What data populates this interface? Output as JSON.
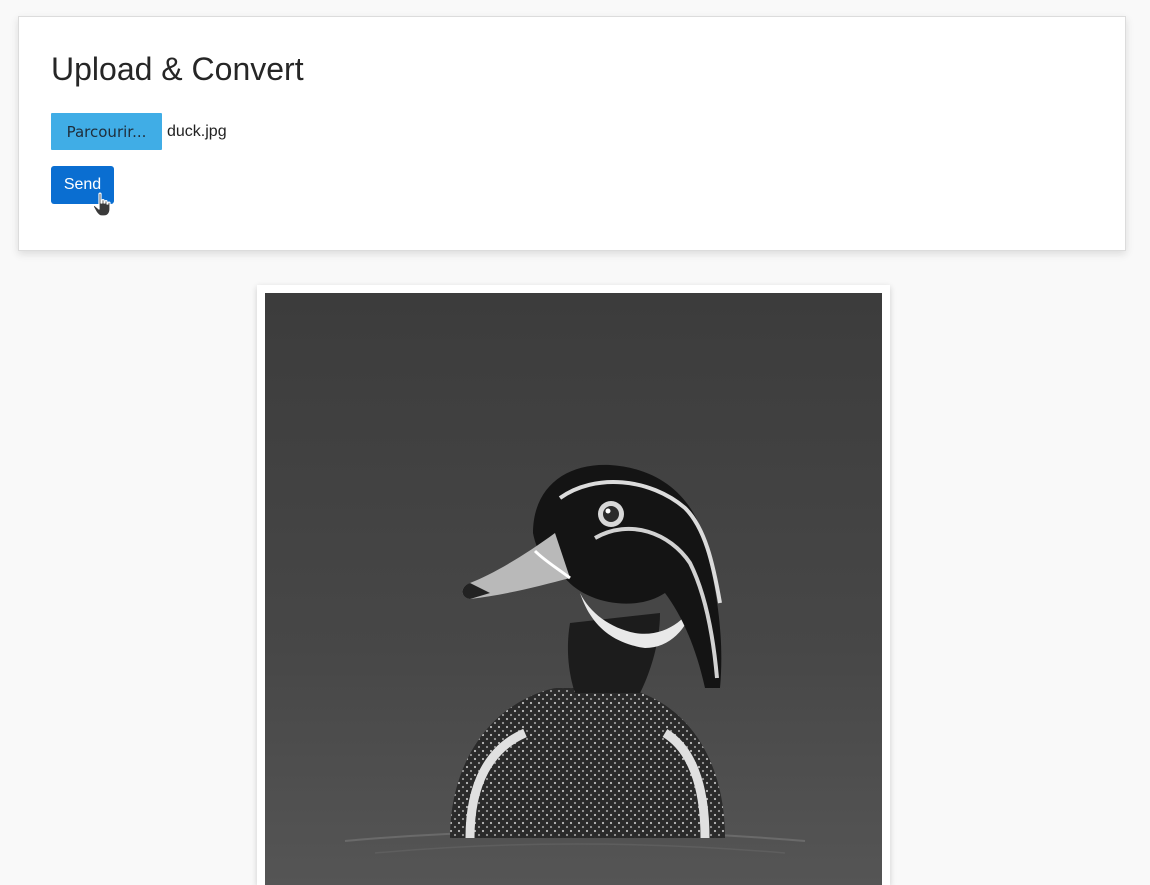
{
  "upload": {
    "title": "Upload & Convert",
    "browse_label": "Parcourir...",
    "file_name": "duck.jpg",
    "send_label": "Send"
  },
  "result": {
    "image_description_icon": "duck-photo",
    "colors": {
      "browse_button": "#40ade6",
      "send_button": "#0a6ed1"
    }
  }
}
